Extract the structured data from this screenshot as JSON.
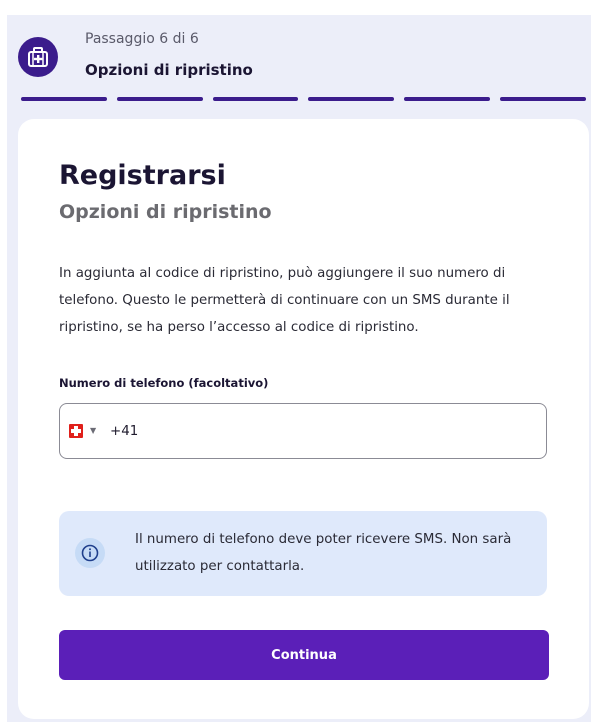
{
  "colors": {
    "brand": "#3b1c8c",
    "button": "#5b1fb8",
    "progress_done": "#3b1c8c",
    "info_bg": "#dfe9fb"
  },
  "header": {
    "step_counter": "Passaggio 6 di 6",
    "step_title": "Opzioni di ripristino",
    "icon": "first-aid-kit-icon",
    "progress": {
      "current_step": 6,
      "total_steps": 6
    }
  },
  "card": {
    "title": "Registrarsi",
    "subtitle": "Opzioni di ripristino",
    "intro": "In aggiunta al codice di ripristino, può aggiungere il suo numero di telefono. Questo le permetterà di continuare con un SMS durante il ripristino, se ha perso l’accesso al codice di ripristino.",
    "phone": {
      "label": "Numero di telefono (facoltativo)",
      "country_flag": "swiss-flag-icon",
      "value": "+41"
    },
    "info": {
      "icon": "info-icon",
      "text": "Il numero di telefono deve poter ricevere SMS. Non sarà utilizzato per contattarla."
    },
    "continue_label": "Continua"
  }
}
